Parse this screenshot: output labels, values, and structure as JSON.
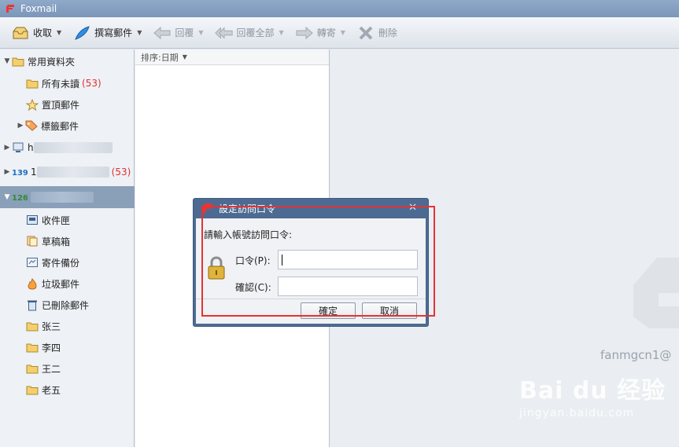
{
  "window": {
    "title": "Foxmail"
  },
  "toolbar": {
    "receive": "收取",
    "compose": "撰寫郵件",
    "reply": "回覆",
    "reply_all": "回覆全部",
    "forward": "轉寄",
    "delete": "刪除"
  },
  "sidebar": {
    "common_folder": "常用資料夾",
    "unread": "所有未讀",
    "unread_count": "(53)",
    "pinned": "置頂郵件",
    "tagged": "標籤郵件",
    "account1_prefix": "h",
    "account2_prefix": "1",
    "account2_count": "(53)",
    "inbox": "收件匣",
    "drafts": "草稿箱",
    "sent": "寄件備份",
    "junk": "垃圾郵件",
    "trash": "已刪除郵件",
    "folders": [
      "张三",
      "李四",
      "王二",
      "老五"
    ]
  },
  "msglist": {
    "sort_label": "排序:日期"
  },
  "preview": {
    "account_text": "fanmgcn1@"
  },
  "dialog": {
    "title": "設定訪問口令",
    "prompt": "請輸入帳號訪問口令:",
    "password_label": "口令(P):",
    "confirm_label": "確認(C):",
    "ok": "確定",
    "cancel": "取消"
  },
  "watermark": {
    "logo": "Bai du 经验",
    "url": "jingyan.baidu.com"
  }
}
